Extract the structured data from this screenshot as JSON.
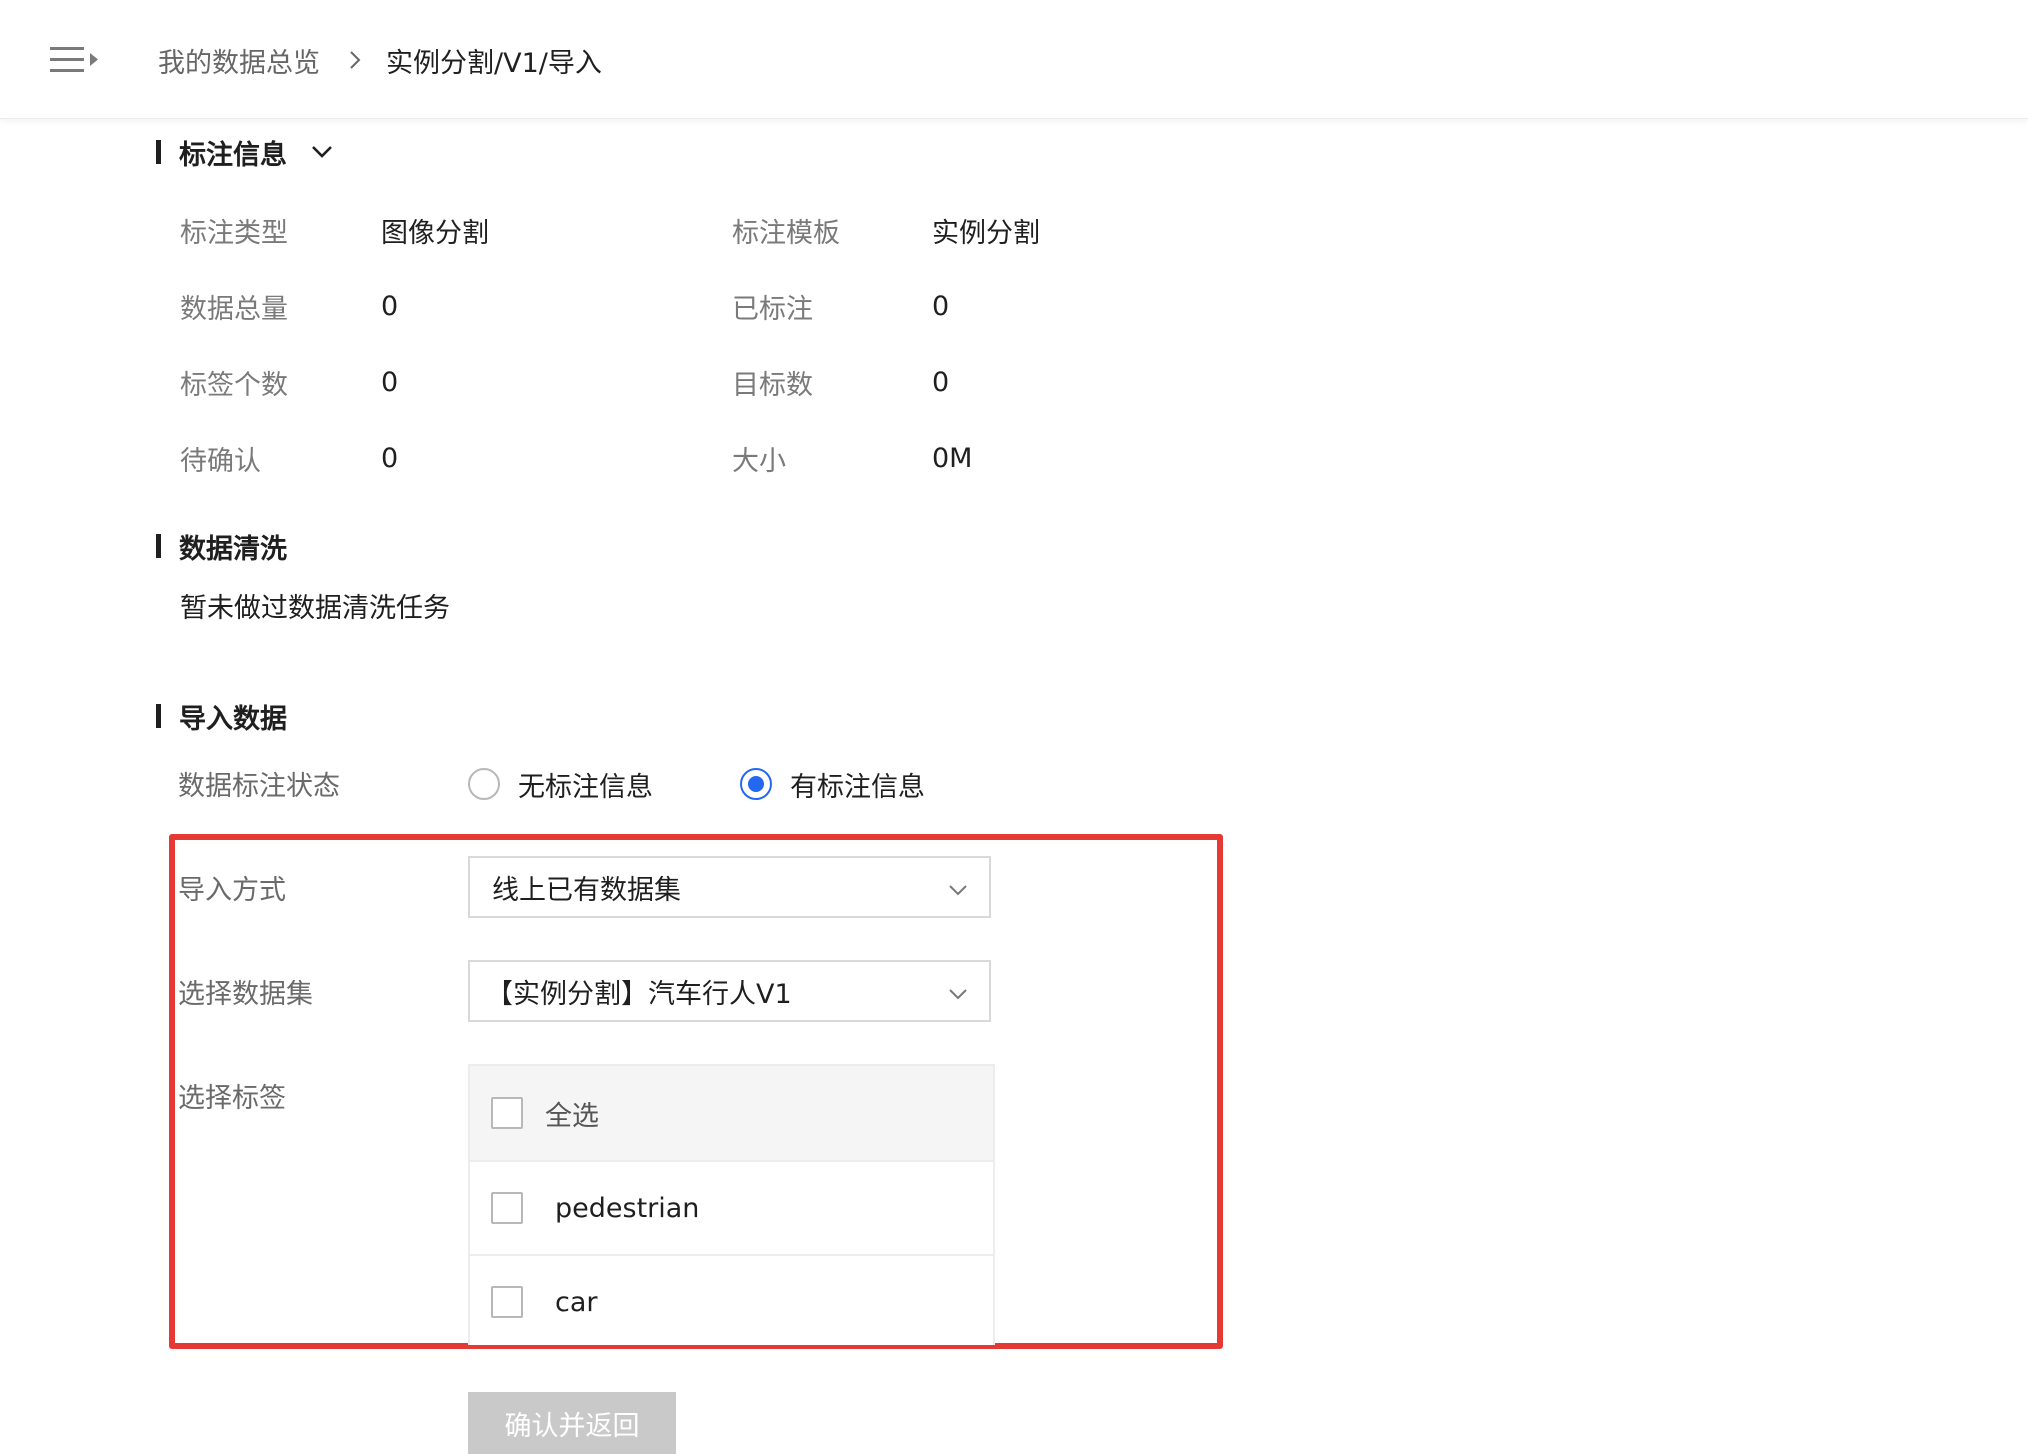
{
  "breadcrumb": {
    "home": "我的数据总览",
    "current": "实例分割/V1/导入"
  },
  "annotation_info": {
    "title": "标注信息",
    "fields": [
      {
        "label": "标注类型",
        "value": "图像分割"
      },
      {
        "label": "标注模板",
        "value": "实例分割"
      },
      {
        "label": "数据总量",
        "value": "0"
      },
      {
        "label": "已标注",
        "value": "0"
      },
      {
        "label": "标签个数",
        "value": "0"
      },
      {
        "label": "目标数",
        "value": "0"
      },
      {
        "label": "待确认",
        "value": "0"
      },
      {
        "label": "大小",
        "value": "0M"
      }
    ]
  },
  "data_cleaning": {
    "title": "数据清洗",
    "empty_text": "暂未做过数据清洗任务"
  },
  "import_data": {
    "title": "导入数据",
    "status_label": "数据标注状态",
    "status_options": [
      {
        "label": "无标注信息",
        "checked": false
      },
      {
        "label": "有标注信息",
        "checked": true
      }
    ],
    "import_method_label": "导入方式",
    "import_method_value": "线上已有数据集",
    "dataset_label": "选择数据集",
    "dataset_value": "【实例分割】汽车行人V1",
    "tags_label": "选择标签",
    "select_all_label": "全选",
    "tags": [
      "pedestrian",
      "car"
    ],
    "confirm_label": "确认并返回"
  },
  "colors": {
    "accent": "#2468f2",
    "highlight": "#e53935",
    "disabled_button": "#c9c9c9"
  },
  "icons": {
    "menu": "menu-collapse-icon",
    "breadcrumb_separator": "chevron-right-icon",
    "collapse": "chevron-down-icon",
    "select_arrow": "chevron-down-icon"
  }
}
